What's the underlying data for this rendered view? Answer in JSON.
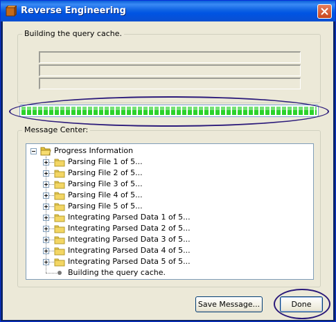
{
  "window": {
    "title": "Reverse Engineering"
  },
  "status_group": {
    "legend": "Building the query cache.",
    "lines": [
      "",
      "",
      ""
    ]
  },
  "progress": {
    "fraction": 1.0,
    "color": "#2bd22b"
  },
  "message_center": {
    "legend": "Message Center:",
    "root": {
      "label": "Progress Information",
      "icon": "folder-open-icon"
    },
    "items": [
      {
        "label": "Parsing File 1 of 5...",
        "icon": "folder-icon"
      },
      {
        "label": "Parsing File 2 of 5...",
        "icon": "folder-icon"
      },
      {
        "label": "Parsing File 3 of 5...",
        "icon": "folder-icon"
      },
      {
        "label": "Parsing File 4 of 5...",
        "icon": "folder-icon"
      },
      {
        "label": "Parsing File 5 of 5...",
        "icon": "folder-icon"
      },
      {
        "label": "Integrating Parsed Data 1 of 5...",
        "icon": "folder-icon"
      },
      {
        "label": "Integrating Parsed Data 2 of 5...",
        "icon": "folder-icon"
      },
      {
        "label": "Integrating Parsed Data 3 of 5...",
        "icon": "folder-icon"
      },
      {
        "label": "Integrating Parsed Data 4 of 5...",
        "icon": "folder-icon"
      },
      {
        "label": "Integrating Parsed Data 5 of 5...",
        "icon": "folder-icon"
      }
    ],
    "leaf": {
      "label": "Building the query cache.",
      "icon": "bullet-icon"
    }
  },
  "buttons": {
    "save_message": "Save Message...",
    "done": "Done"
  },
  "colors": {
    "titlebar": "#0054e3",
    "dialog_bg": "#ece9d8",
    "annotation_ellipse": "#2b1a7a"
  }
}
